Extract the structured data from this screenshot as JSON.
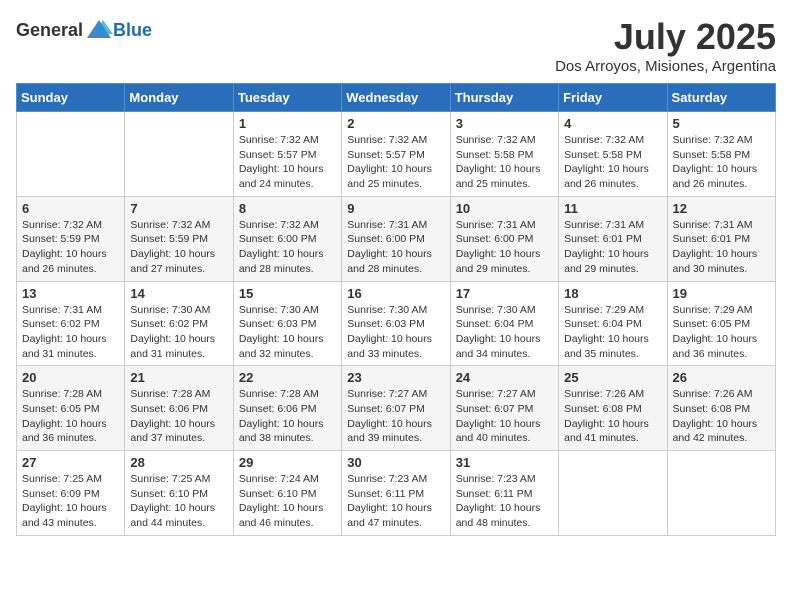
{
  "logo": {
    "text_general": "General",
    "text_blue": "Blue"
  },
  "title": "July 2025",
  "location": "Dos Arroyos, Misiones, Argentina",
  "days_of_week": [
    "Sunday",
    "Monday",
    "Tuesday",
    "Wednesday",
    "Thursday",
    "Friday",
    "Saturday"
  ],
  "weeks": [
    [
      {
        "day": "",
        "info": ""
      },
      {
        "day": "",
        "info": ""
      },
      {
        "day": "1",
        "info": "Sunrise: 7:32 AM\nSunset: 5:57 PM\nDaylight: 10 hours and 24 minutes."
      },
      {
        "day": "2",
        "info": "Sunrise: 7:32 AM\nSunset: 5:57 PM\nDaylight: 10 hours and 25 minutes."
      },
      {
        "day": "3",
        "info": "Sunrise: 7:32 AM\nSunset: 5:58 PM\nDaylight: 10 hours and 25 minutes."
      },
      {
        "day": "4",
        "info": "Sunrise: 7:32 AM\nSunset: 5:58 PM\nDaylight: 10 hours and 26 minutes."
      },
      {
        "day": "5",
        "info": "Sunrise: 7:32 AM\nSunset: 5:58 PM\nDaylight: 10 hours and 26 minutes."
      }
    ],
    [
      {
        "day": "6",
        "info": "Sunrise: 7:32 AM\nSunset: 5:59 PM\nDaylight: 10 hours and 26 minutes."
      },
      {
        "day": "7",
        "info": "Sunrise: 7:32 AM\nSunset: 5:59 PM\nDaylight: 10 hours and 27 minutes."
      },
      {
        "day": "8",
        "info": "Sunrise: 7:32 AM\nSunset: 6:00 PM\nDaylight: 10 hours and 28 minutes."
      },
      {
        "day": "9",
        "info": "Sunrise: 7:31 AM\nSunset: 6:00 PM\nDaylight: 10 hours and 28 minutes."
      },
      {
        "day": "10",
        "info": "Sunrise: 7:31 AM\nSunset: 6:00 PM\nDaylight: 10 hours and 29 minutes."
      },
      {
        "day": "11",
        "info": "Sunrise: 7:31 AM\nSunset: 6:01 PM\nDaylight: 10 hours and 29 minutes."
      },
      {
        "day": "12",
        "info": "Sunrise: 7:31 AM\nSunset: 6:01 PM\nDaylight: 10 hours and 30 minutes."
      }
    ],
    [
      {
        "day": "13",
        "info": "Sunrise: 7:31 AM\nSunset: 6:02 PM\nDaylight: 10 hours and 31 minutes."
      },
      {
        "day": "14",
        "info": "Sunrise: 7:30 AM\nSunset: 6:02 PM\nDaylight: 10 hours and 31 minutes."
      },
      {
        "day": "15",
        "info": "Sunrise: 7:30 AM\nSunset: 6:03 PM\nDaylight: 10 hours and 32 minutes."
      },
      {
        "day": "16",
        "info": "Sunrise: 7:30 AM\nSunset: 6:03 PM\nDaylight: 10 hours and 33 minutes."
      },
      {
        "day": "17",
        "info": "Sunrise: 7:30 AM\nSunset: 6:04 PM\nDaylight: 10 hours and 34 minutes."
      },
      {
        "day": "18",
        "info": "Sunrise: 7:29 AM\nSunset: 6:04 PM\nDaylight: 10 hours and 35 minutes."
      },
      {
        "day": "19",
        "info": "Sunrise: 7:29 AM\nSunset: 6:05 PM\nDaylight: 10 hours and 36 minutes."
      }
    ],
    [
      {
        "day": "20",
        "info": "Sunrise: 7:28 AM\nSunset: 6:05 PM\nDaylight: 10 hours and 36 minutes."
      },
      {
        "day": "21",
        "info": "Sunrise: 7:28 AM\nSunset: 6:06 PM\nDaylight: 10 hours and 37 minutes."
      },
      {
        "day": "22",
        "info": "Sunrise: 7:28 AM\nSunset: 6:06 PM\nDaylight: 10 hours and 38 minutes."
      },
      {
        "day": "23",
        "info": "Sunrise: 7:27 AM\nSunset: 6:07 PM\nDaylight: 10 hours and 39 minutes."
      },
      {
        "day": "24",
        "info": "Sunrise: 7:27 AM\nSunset: 6:07 PM\nDaylight: 10 hours and 40 minutes."
      },
      {
        "day": "25",
        "info": "Sunrise: 7:26 AM\nSunset: 6:08 PM\nDaylight: 10 hours and 41 minutes."
      },
      {
        "day": "26",
        "info": "Sunrise: 7:26 AM\nSunset: 6:08 PM\nDaylight: 10 hours and 42 minutes."
      }
    ],
    [
      {
        "day": "27",
        "info": "Sunrise: 7:25 AM\nSunset: 6:09 PM\nDaylight: 10 hours and 43 minutes."
      },
      {
        "day": "28",
        "info": "Sunrise: 7:25 AM\nSunset: 6:10 PM\nDaylight: 10 hours and 44 minutes."
      },
      {
        "day": "29",
        "info": "Sunrise: 7:24 AM\nSunset: 6:10 PM\nDaylight: 10 hours and 46 minutes."
      },
      {
        "day": "30",
        "info": "Sunrise: 7:23 AM\nSunset: 6:11 PM\nDaylight: 10 hours and 47 minutes."
      },
      {
        "day": "31",
        "info": "Sunrise: 7:23 AM\nSunset: 6:11 PM\nDaylight: 10 hours and 48 minutes."
      },
      {
        "day": "",
        "info": ""
      },
      {
        "day": "",
        "info": ""
      }
    ]
  ]
}
